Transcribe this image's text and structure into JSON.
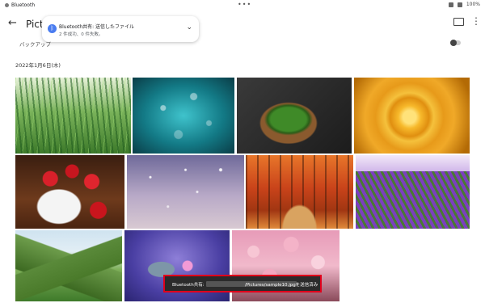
{
  "status_bar": {
    "app": "Bluetooth",
    "center_dots": "•••",
    "battery": "100%"
  },
  "app_bar": {
    "title": "Pictures",
    "back_icon": "arrow-back-icon",
    "cast_icon": "cast-icon",
    "more_icon": "more-vert-icon"
  },
  "notification": {
    "title": "Bluetooth共有: 送信したファイル",
    "subtitle": "2 件成功、0 件失敗。",
    "icon": "bluetooth-icon"
  },
  "backup": {
    "label": "バックアップ",
    "enabled": false
  },
  "section": {
    "date": "2022年1月6日(木)"
  },
  "photos": [
    {
      "subject": "grass with dew drops"
    },
    {
      "subject": "turquoise water droplets"
    },
    {
      "subject": "basil leaves in bowl"
    },
    {
      "subject": "yellow rose"
    },
    {
      "subject": "strawberries in bowl"
    },
    {
      "subject": "falling snow at dusk"
    },
    {
      "subject": "autumn forest path"
    },
    {
      "subject": "lavender field"
    },
    {
      "subject": "green mountain valley"
    },
    {
      "subject": "lotus and lily pads"
    },
    {
      "subject": "cherry blossoms"
    }
  ],
  "toast": {
    "prefix": "Bluetooth共有:",
    "suffix": "/Pictures/sample10.jpgを送信済み"
  },
  "colors": {
    "toast_highlight": "#e0001b",
    "accent": "#4a7cf0"
  }
}
